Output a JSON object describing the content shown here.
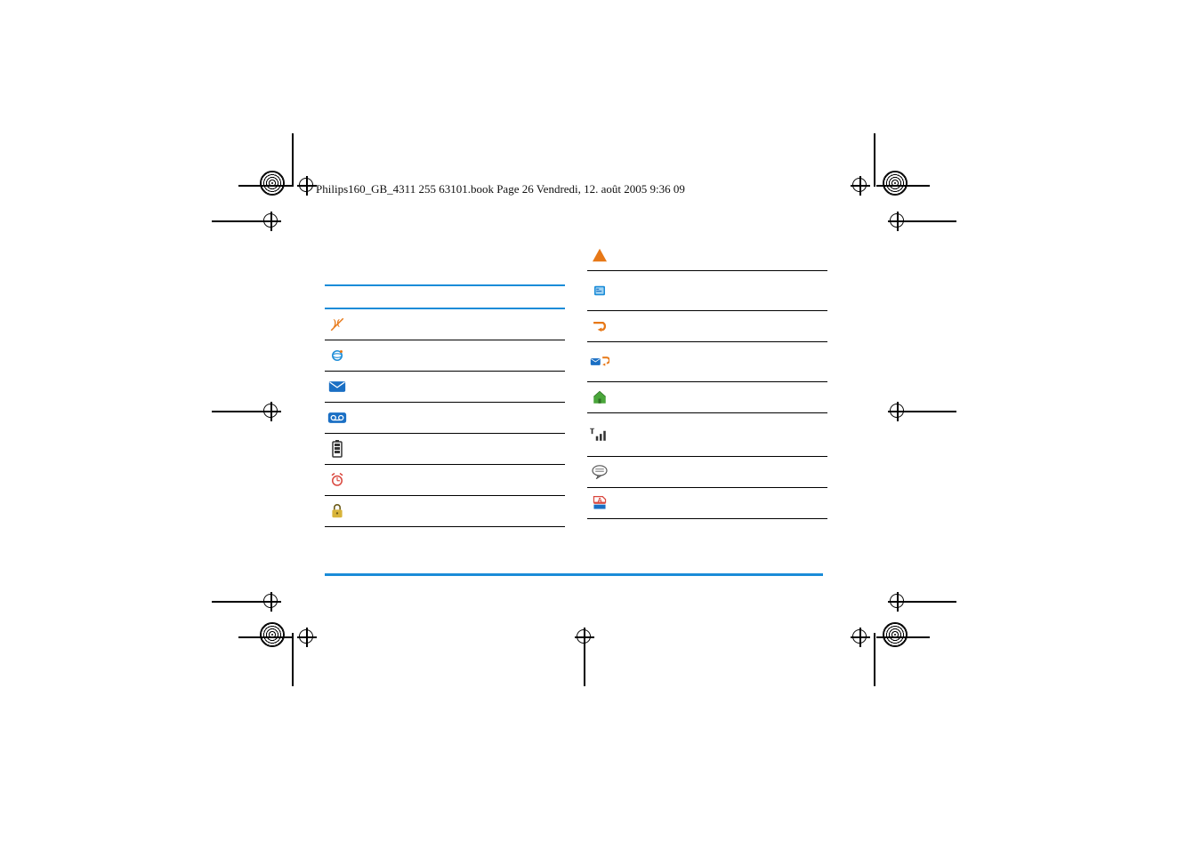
{
  "header_text": "Philips160_GB_4311 255 63101.book  Page 26  Vendredi, 12. août 2005  9:36 09",
  "left_icons": [
    {
      "name": "silent-icon"
    },
    {
      "name": "gprs-icon"
    },
    {
      "name": "sms-envelope-icon"
    },
    {
      "name": "voice-mail-icon"
    },
    {
      "name": "battery-icon"
    },
    {
      "name": "alarm-clock-icon"
    },
    {
      "name": "keypad-lock-icon"
    }
  ],
  "right_icons": [
    {
      "name": "roaming-triangle-icon"
    },
    {
      "name": "sms-full-icon"
    },
    {
      "name": "call-forward-unconditional-icon"
    },
    {
      "name": "call-forward-to-mailbox-icon"
    },
    {
      "name": "home-zone-icon"
    },
    {
      "name": "network-signal-icon"
    },
    {
      "name": "sms-chat-icon"
    },
    {
      "name": "memory-full-icon"
    }
  ]
}
